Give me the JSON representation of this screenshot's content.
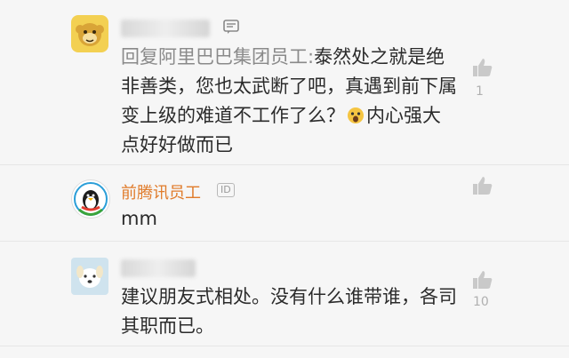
{
  "comments": [
    {
      "avatar_icon": "monkey-avatar-icon",
      "name": "",
      "reply_prefix": "回复阿里巴巴集团员工:",
      "text": "泰然处之就是绝非善类，您也太武断了吧，真遇到前下属变上级的难道不工作了么？",
      "emoji": "scared-face-emoji",
      "text_after_emoji": "内心强大点好好做而已",
      "likes": "1"
    },
    {
      "avatar_icon": "tencent-penguin-avatar-icon",
      "name": "前腾讯员工",
      "badge": "ID",
      "text": "mm",
      "likes": ""
    },
    {
      "avatar_icon": "dog-avatar-icon",
      "name": "",
      "text": "建议朋友式相处。没有什么谁带谁，各司其职而已。",
      "likes": "10"
    }
  ]
}
